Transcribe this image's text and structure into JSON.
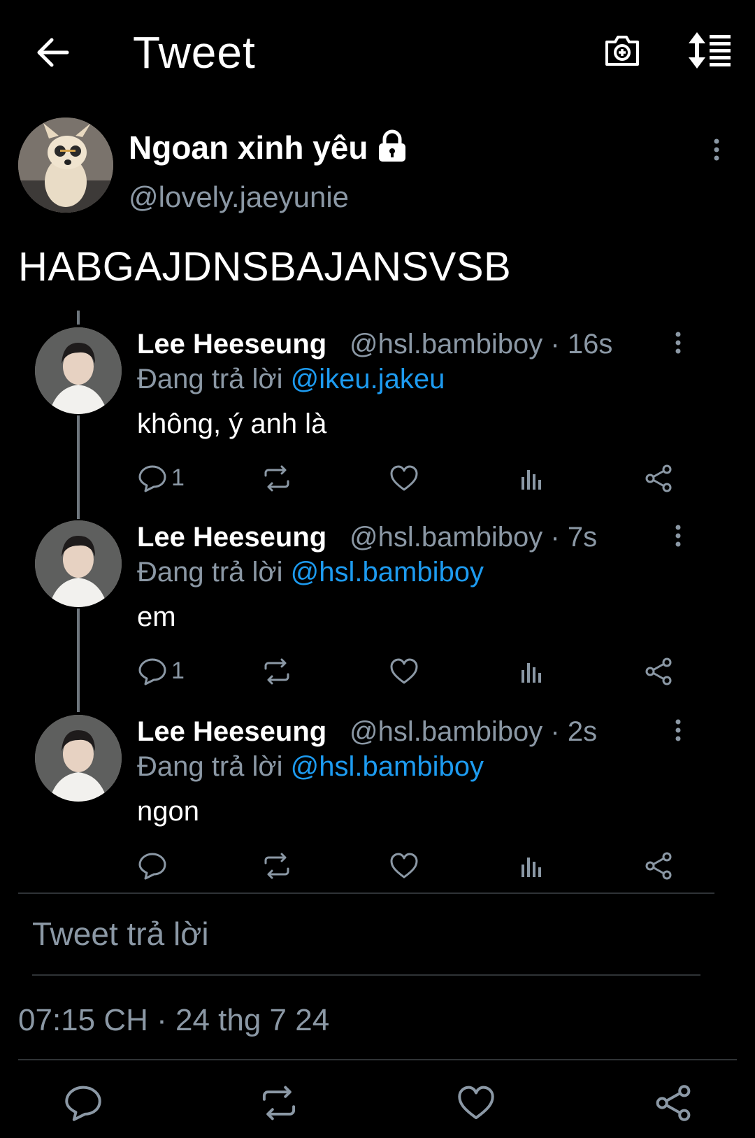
{
  "header": {
    "title": "Tweet",
    "back_icon": "arrow-left-icon",
    "camera_icon": "camera-plus-icon",
    "sort_icon": "sort-list-icon"
  },
  "main_tweet": {
    "display_name": "Ngoan xinh yêu",
    "handle": "@lovely.jaeyunie",
    "protected_icon": "lock-icon",
    "text": "HABGAJDNSBAJANSVSB",
    "timestamp": "07:15 CH · 24 thg 7 24"
  },
  "replies": [
    {
      "display_name": "Lee Heeseung",
      "handle_time": "@hsl.bambiboy · 16s",
      "replying_prefix": "Đang trả lời ",
      "replying_to": "@ikeu.jakeu",
      "text": "không, ý anh là",
      "reply_count": "1"
    },
    {
      "display_name": "Lee Heeseung",
      "handle_time": "@hsl.bambiboy · 7s",
      "replying_prefix": "Đang trả lời ",
      "replying_to": "@hsl.bambiboy",
      "text": "em",
      "reply_count": "1"
    },
    {
      "display_name": "Lee Heeseung",
      "handle_time": "@hsl.bambiboy · 2s",
      "replying_prefix": "Đang trả lời ",
      "replying_to": "@hsl.bambiboy",
      "text": "ngon",
      "reply_count": ""
    }
  ],
  "compose": {
    "placeholder": "Tweet trả lời"
  },
  "colors": {
    "background": "#000000",
    "secondary_text": "#8b98a5",
    "mention": "#1d9bf0",
    "divider": "#2f3336"
  }
}
